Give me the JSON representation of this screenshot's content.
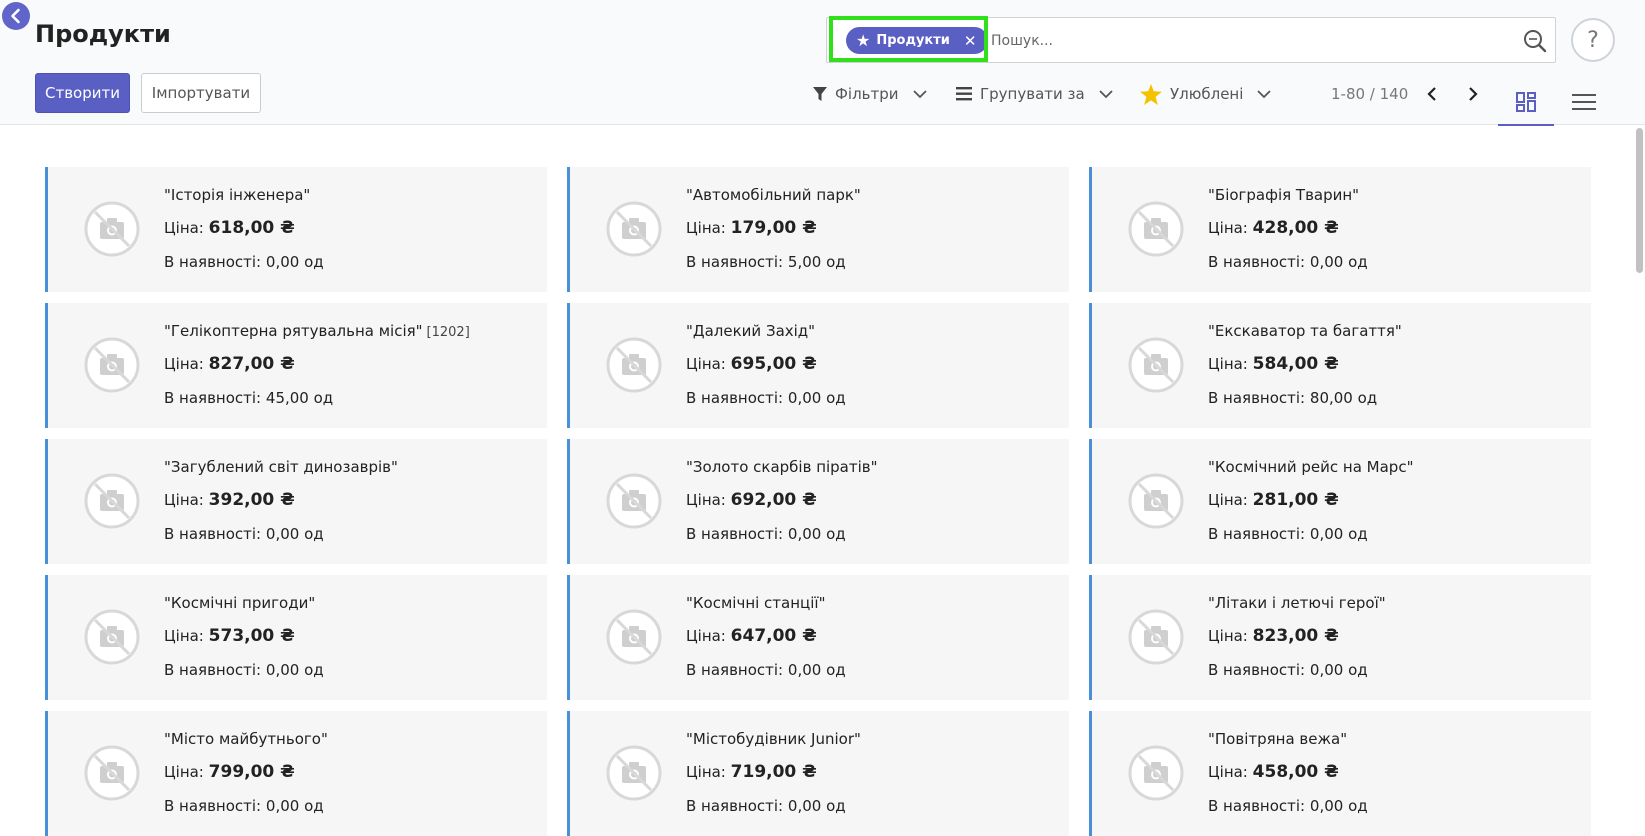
{
  "header": {
    "title": "Продукти",
    "create_label": "Створити",
    "import_label": "Імпортувати"
  },
  "search": {
    "facet_label": "Продукти",
    "placeholder": "Пошук..."
  },
  "help_label": "?",
  "toolbar": {
    "filters_label": "Фільтри",
    "group_label": "Групувати за",
    "favorites_label": "Улюблені"
  },
  "pager": {
    "value": "1-80 / 140"
  },
  "colors": {
    "accent": "#5a5fc4",
    "highlight": "#2fe01a",
    "card_border": "#4a90d9",
    "favorite_star": "#f3c300"
  },
  "labels": {
    "price": "Ціна:",
    "stock": "В наявності:"
  },
  "products": [
    {
      "name": "\"Історія інженера\"",
      "ref": "",
      "price": "618,00 ₴",
      "stock": "0,00 од"
    },
    {
      "name": "\"Автомобільний парк\"",
      "ref": "",
      "price": "179,00 ₴",
      "stock": "5,00 од"
    },
    {
      "name": "\"Біографія Тварин\"",
      "ref": "",
      "price": "428,00 ₴",
      "stock": "0,00 од"
    },
    {
      "name": "\"Гелікоптерна рятувальна місія\"",
      "ref": "[1202]",
      "price": "827,00 ₴",
      "stock": "45,00 од"
    },
    {
      "name": "\"Далекий Захід\"",
      "ref": "",
      "price": "695,00 ₴",
      "stock": "0,00 од"
    },
    {
      "name": "\"Екскаватор та багаття\"",
      "ref": "",
      "price": "584,00 ₴",
      "stock": "80,00 од"
    },
    {
      "name": "\"Загублений світ динозаврів\"",
      "ref": "",
      "price": "392,00 ₴",
      "stock": "0,00 од"
    },
    {
      "name": "\"Золото скарбів піратів\"",
      "ref": "",
      "price": "692,00 ₴",
      "stock": "0,00 од"
    },
    {
      "name": "\"Космічний рейс на Марс\"",
      "ref": "",
      "price": "281,00 ₴",
      "stock": "0,00 од"
    },
    {
      "name": "\"Космічні пригоди\"",
      "ref": "",
      "price": "573,00 ₴",
      "stock": "0,00 од"
    },
    {
      "name": "\"Космічні станції\"",
      "ref": "",
      "price": "647,00 ₴",
      "stock": "0,00 од"
    },
    {
      "name": "\"Літаки і летючі герої\"",
      "ref": "",
      "price": "823,00 ₴",
      "stock": "0,00 од"
    },
    {
      "name": "\"Місто майбутнього\"",
      "ref": "",
      "price": "799,00 ₴",
      "stock": "0,00 од"
    },
    {
      "name": "\"Містобудівник Junior\"",
      "ref": "",
      "price": "719,00 ₴",
      "stock": "0,00 од"
    },
    {
      "name": "\"Повітряна вежа\"",
      "ref": "",
      "price": "458,00 ₴",
      "stock": "0,00 од"
    }
  ]
}
